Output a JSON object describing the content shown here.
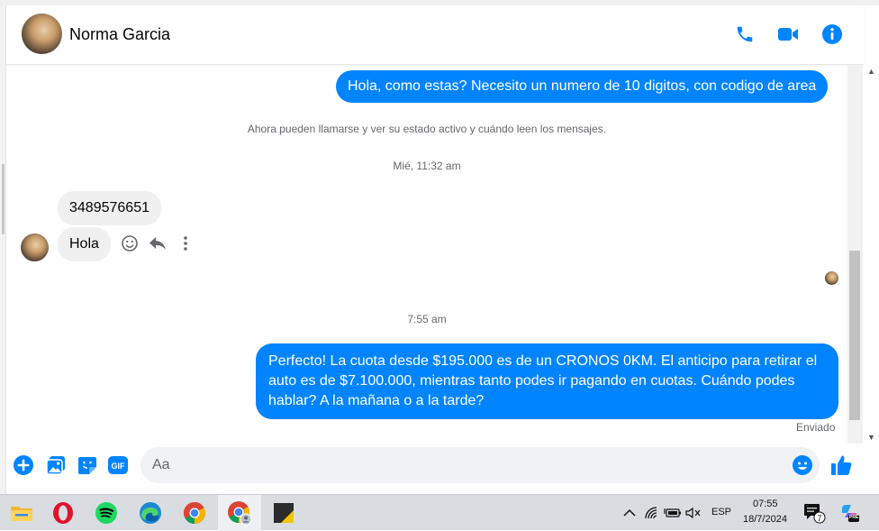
{
  "header": {
    "contact_name": "Norma Garcia",
    "icons": [
      "phone-icon",
      "video-camera-icon",
      "info-icon"
    ]
  },
  "messages": {
    "out1": "Hola, como estas? Necesito un numero de 10 digitos, con codigo de area",
    "system_notice": "Ahora pueden llamarse y ver su estado activo y cuándo leen los mensajes.",
    "timestamp1": "Mié, 11:32 am",
    "in1": "3489576651",
    "in2": "Hola",
    "timestamp2": "7:55 am",
    "out2": "Perfecto! La cuota desde $195.000 es de un CRONOS 0KM. El anticipo para retirar el auto es de $7.100.000, mientras tanto podes ir pagando en cuotas. Cuándo podes hablar? A la mañana o a la tarde?",
    "status": "Enviado"
  },
  "composer": {
    "placeholder": "Aa",
    "gif_label": "GIF"
  },
  "taskbar": {
    "apps": [
      "file-explorer",
      "opera",
      "spotify",
      "edge",
      "chrome",
      "chrome-profile",
      "sticky-app"
    ],
    "language": "ESP",
    "time": "07:55",
    "date": "18/7/2024",
    "notification_count": "7",
    "copilot_badge": "PRE"
  },
  "colors": {
    "accent": "#0084ff",
    "incoming_bubble": "#f0f0f0",
    "taskbar": "#d9dde2"
  }
}
